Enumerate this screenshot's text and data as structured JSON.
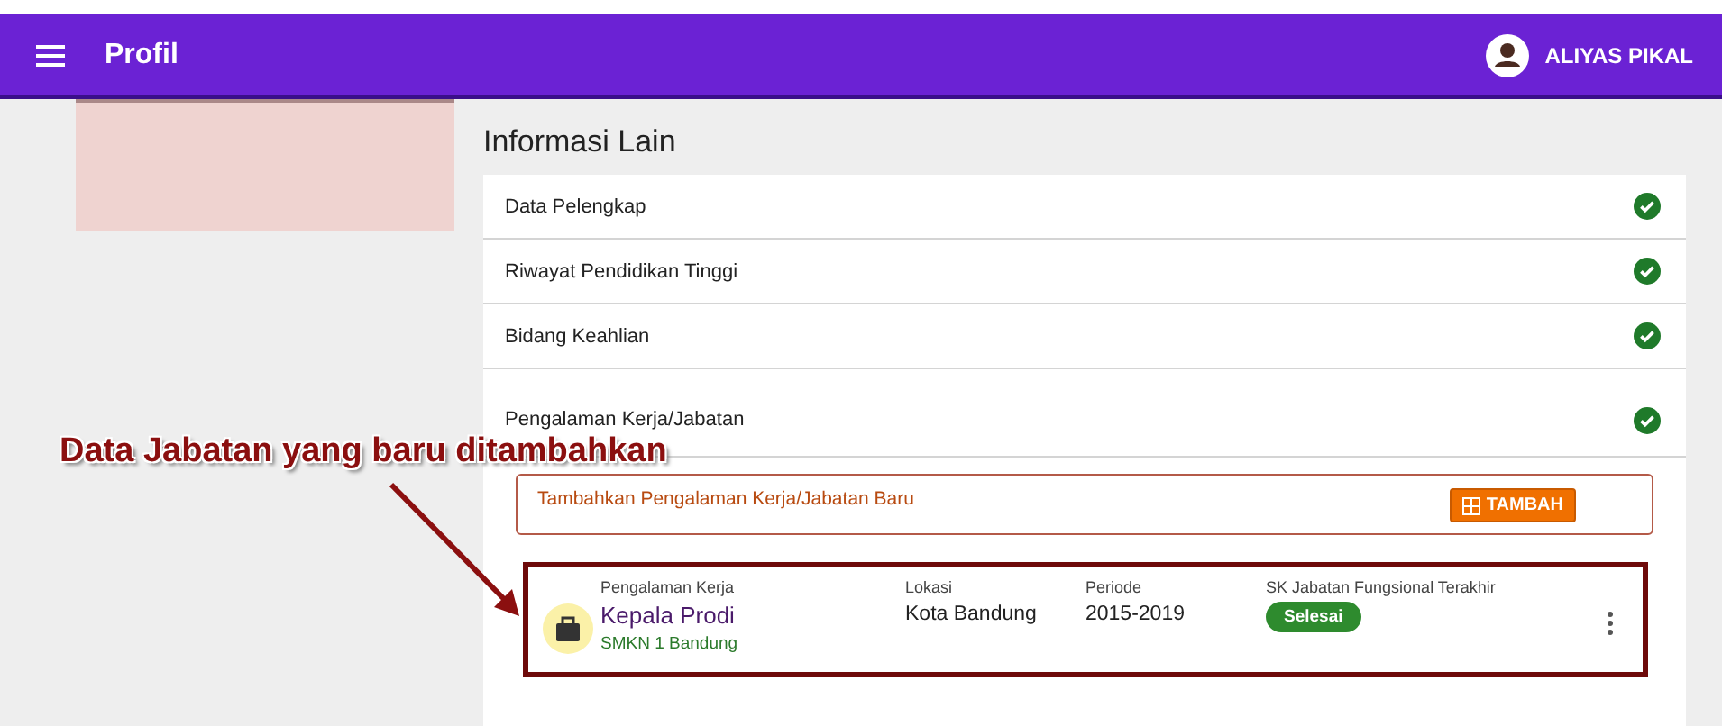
{
  "header": {
    "title": "Profil",
    "user": "ALIYAS PIKAL"
  },
  "section": {
    "title": "Informasi Lain",
    "items": [
      {
        "label": "Data Pelengkap",
        "completed": true
      },
      {
        "label": "Riwayat Pendidikan Tinggi",
        "completed": true
      },
      {
        "label": "Bidang Keahlian",
        "completed": true
      },
      {
        "label": "Pengalaman Kerja/Jabatan",
        "completed": true
      }
    ]
  },
  "add_panel": {
    "text": "Tambahkan Pengalaman Kerja/Jabatan Baru",
    "button": "TAMBAH"
  },
  "entries": [
    {
      "category_label": "Pengalaman Kerja",
      "title": "Kepala Prodi",
      "institution": "SMKN 1 Bandung",
      "location_label": "Lokasi",
      "location": "Kota Bandung",
      "period_label": "Periode",
      "period": "2015-2019",
      "sk_label": "SK Jabatan Fungsional Terakhir",
      "sk_status": "Selesai",
      "highlighted": true
    }
  ],
  "annotation": {
    "text": "Data Jabatan yang baru ditambahkan"
  }
}
